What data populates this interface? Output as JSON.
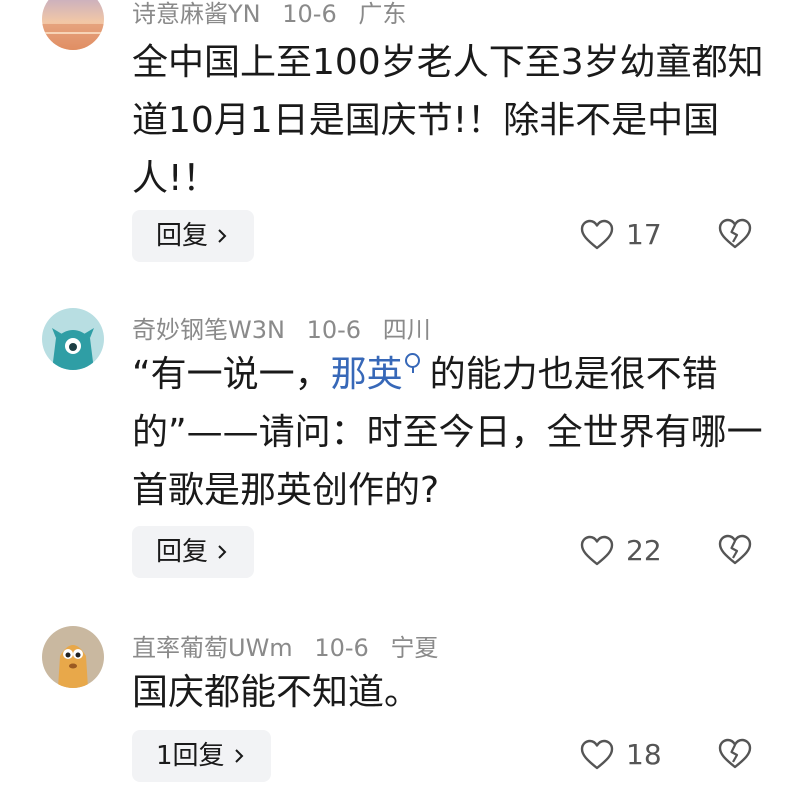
{
  "comments": [
    {
      "username": "诗意麻酱YN",
      "date": "10-6",
      "location": "广东",
      "text": "全中国上至100岁老人下至3岁幼童都知道10月1日是国庆节!！除非不是中国人!！",
      "reply_label": "回复",
      "likes": "17"
    },
    {
      "username": "奇妙钢笔W3N",
      "date": "10-6",
      "location": "四川",
      "text_before": "“有一说一，",
      "link_text": "那英",
      "text_after": "的能力也是很不错的”——请问：时至今日，全世界有哪一首歌是那英创作的?",
      "reply_label": "回复",
      "likes": "22"
    },
    {
      "username": "直率葡萄UWm",
      "date": "10-6",
      "location": "宁夏",
      "text": "国庆都能不知道。",
      "reply_label": "1回复",
      "likes": "18"
    }
  ],
  "icons": {
    "like": "heart-outline-icon",
    "dislike": "broken-heart-icon",
    "reply_arrow": "chevron-right-icon"
  },
  "colors": {
    "link": "#3768b8",
    "meta": "#8a8a8a",
    "button_bg": "#f2f3f5"
  }
}
